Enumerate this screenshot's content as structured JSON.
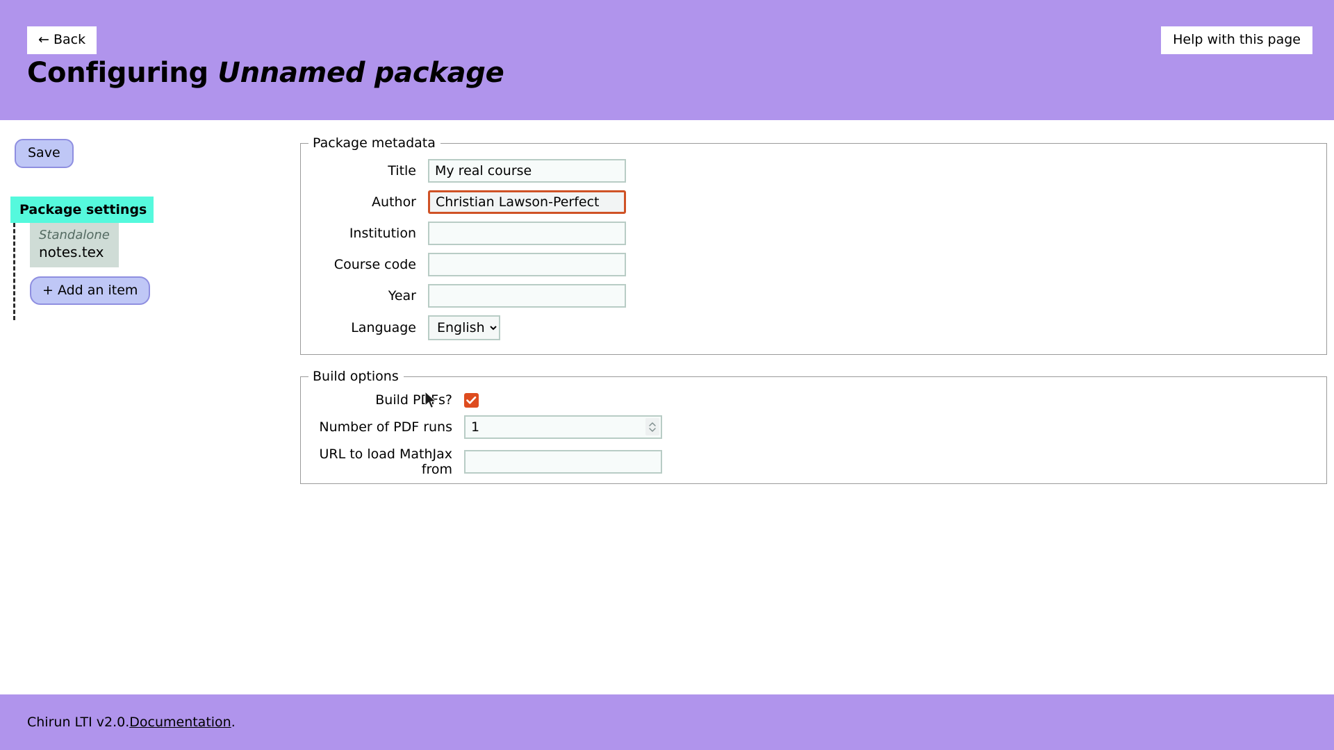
{
  "header": {
    "back_label": "← Back",
    "help_label": "Help with this page",
    "title_prefix": "Configuring ",
    "package_name": "Unnamed package",
    "background_color": "#b094ec"
  },
  "sidebar": {
    "save_label": "Save",
    "settings_tab_label": "Package settings",
    "settings_tab_color": "#55f9dd",
    "items": [
      {
        "kind": "Standalone",
        "filename": "notes.tex"
      }
    ],
    "add_item_label": "+ Add an item"
  },
  "main": {
    "metadata": {
      "legend": "Package metadata",
      "fields": [
        {
          "label": "Title",
          "value": "My real course",
          "placeholder": "",
          "focused": false
        },
        {
          "label": "Author",
          "value": "Christian Lawson-Perfect",
          "placeholder": "",
          "focused": true
        },
        {
          "label": "Institution",
          "value": "",
          "placeholder": "",
          "focused": false
        },
        {
          "label": "Course code",
          "value": "",
          "placeholder": "",
          "focused": false
        },
        {
          "label": "Year",
          "value": "",
          "placeholder": "",
          "focused": false
        }
      ],
      "language": {
        "label": "Language",
        "selected": "English",
        "options": [
          "English"
        ]
      }
    },
    "build": {
      "legend": "Build options",
      "build_pdfs": {
        "label": "Build PDFs?",
        "checked": true,
        "color": "#de4c1f"
      },
      "pdf_runs": {
        "label": "Number of PDF runs",
        "value": "1",
        "placeholder": ""
      },
      "mathjax_url": {
        "label": "URL to load MathJax from",
        "value": "",
        "placeholder": ""
      }
    }
  },
  "footer": {
    "text_before": "Chirun LTI v2.0. ",
    "link_label": "Documentation",
    "text_after": "."
  }
}
